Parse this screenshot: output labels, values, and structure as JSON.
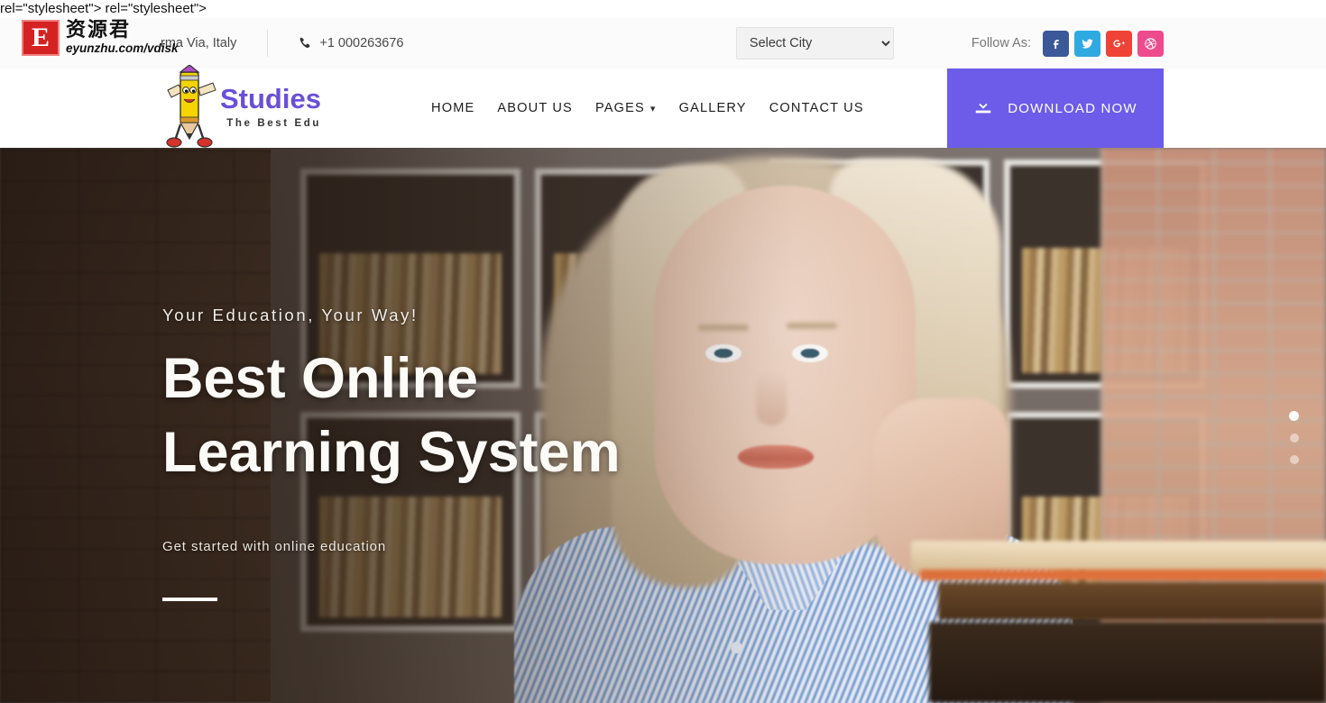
{
  "source_line": "rel=\"stylesheet\"> rel=\"stylesheet\">",
  "watermark": {
    "letter": "E",
    "cn_name": "资源君",
    "url": "eyunzhu.com/vdisk"
  },
  "topbar": {
    "address": "rma Via, Italy",
    "phone": "+1 000263676",
    "city_select": {
      "selected": "Select City",
      "options": [
        "Select City"
      ]
    },
    "follow_label": "Follow As:",
    "socials": [
      {
        "name": "facebook",
        "icon": "facebook-icon",
        "color": "#3b5998"
      },
      {
        "name": "twitter",
        "icon": "twitter-icon",
        "color": "#2eaae1"
      },
      {
        "name": "google-plus",
        "icon": "google-plus-icon",
        "color": "#f04337"
      },
      {
        "name": "dribbble",
        "icon": "dribbble-icon",
        "color": "#ed4b8c"
      }
    ]
  },
  "brand": {
    "name": "Studies",
    "tagline": "The Best Edu",
    "name_color": "#6a4fd8"
  },
  "nav": {
    "items": [
      {
        "label": "HOME",
        "has_dropdown": false
      },
      {
        "label": "ABOUT US",
        "has_dropdown": false
      },
      {
        "label": "PAGES",
        "has_dropdown": true
      },
      {
        "label": "GALLERY",
        "has_dropdown": false
      },
      {
        "label": "CONTACT US",
        "has_dropdown": false
      }
    ]
  },
  "download_button": {
    "label": "DOWNLOAD NOW",
    "icon": "download-icon",
    "color": "#6c5ce9"
  },
  "hero": {
    "subtitle": "Your Education, Your Way!",
    "title_line1": "Best Online",
    "title_line2": "Learning System",
    "description": "Get started with online education",
    "slider_dots": 3,
    "active_dot": 1
  }
}
